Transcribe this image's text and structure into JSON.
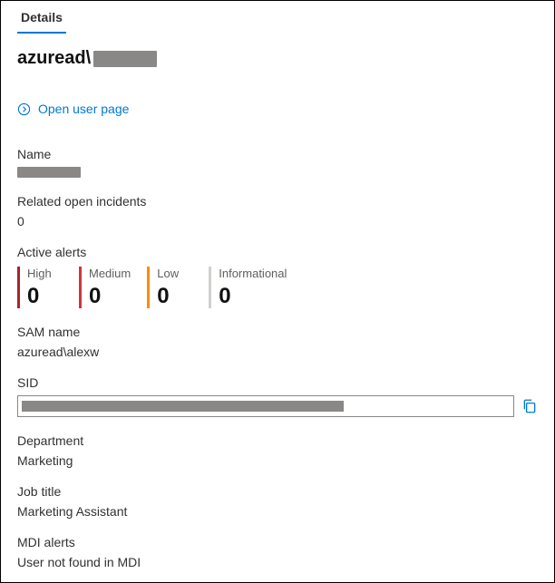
{
  "tabs": {
    "details": "Details"
  },
  "title_prefix": "azuread\\",
  "open_user_page": "Open user page",
  "sections": {
    "name_label": "Name",
    "related_incidents_label": "Related open incidents",
    "related_incidents_value": "0",
    "active_alerts_label": "Active alerts",
    "sam_label": "SAM name",
    "sam_value": "azuread\\alexw",
    "sid_label": "SID",
    "department_label": "Department",
    "department_value": "Marketing",
    "jobtitle_label": "Job title",
    "jobtitle_value": "Marketing Assistant",
    "mdi_label": "MDI alerts",
    "mdi_value": "User not found in MDI"
  },
  "alerts": {
    "high_label": "High",
    "high_count": "0",
    "medium_label": "Medium",
    "medium_count": "0",
    "low_label": "Low",
    "low_count": "0",
    "info_label": "Informational",
    "info_count": "0"
  }
}
